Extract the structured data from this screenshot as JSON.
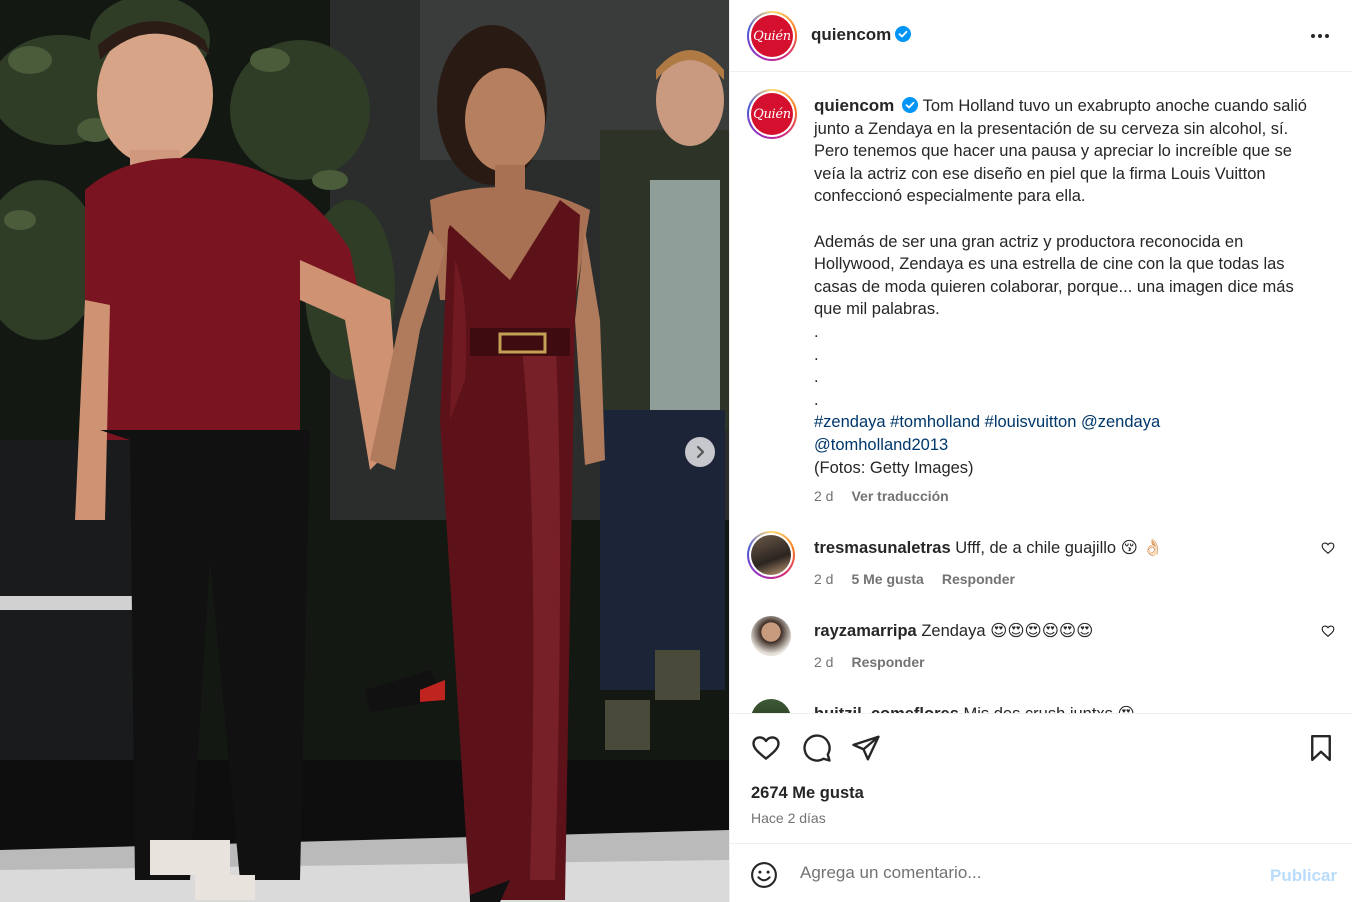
{
  "post": {
    "username": "quiencom",
    "brand_logo": "Quién",
    "verified_icon": "verified-badge-icon",
    "caption": {
      "para1": "Tom Holland tuvo un exabrupto anoche cuando salió junto a Zendaya en la presentación de su cerveza sin alcohol, sí. Pero tenemos que hacer una pausa y apreciar lo increíble que se veía la actriz con ese diseño en piel que la firma Louis Vuitton confeccionó especialmente para ella.",
      "para2": "Además de ser una gran actriz y productora reconocida en Hollywood, Zendaya es una estrella de cine con la que todas las casas de moda quieren colaborar, porque... una imagen dice más que mil palabras.",
      "dots": [
        ".",
        ".",
        ".",
        "."
      ],
      "tags": [
        "#zendaya",
        "#tomholland",
        "#louisvuitton",
        "@zendaya",
        "@tomholland2013"
      ],
      "credit": "(Fotos: Getty Images)",
      "time": "2 d",
      "translate": "Ver traducción"
    },
    "comments": [
      {
        "username": "tresmasunaletras",
        "text": "Ufff, de a chile guajillo 😚 👌🏻",
        "time": "2 d",
        "likes": "5 Me gusta",
        "reply": "Responder"
      },
      {
        "username": "rayzamarripa",
        "text": "Zendaya 😍😍😍😍😍😍",
        "time": "2 d",
        "reply": "Responder"
      },
      {
        "username": "huitzil_comeflores",
        "text": "Mis dos crush juntxs 😍"
      }
    ],
    "likes_count": "2674 Me gusta",
    "posted": "Hace 2 días"
  },
  "composer": {
    "placeholder": "Agrega un comentario...",
    "publish": "Publicar"
  },
  "colors": {
    "brand_red": "#d5102e",
    "link": "#00376b",
    "muted": "#737373",
    "publish_disabled": "#b9dcfb"
  }
}
